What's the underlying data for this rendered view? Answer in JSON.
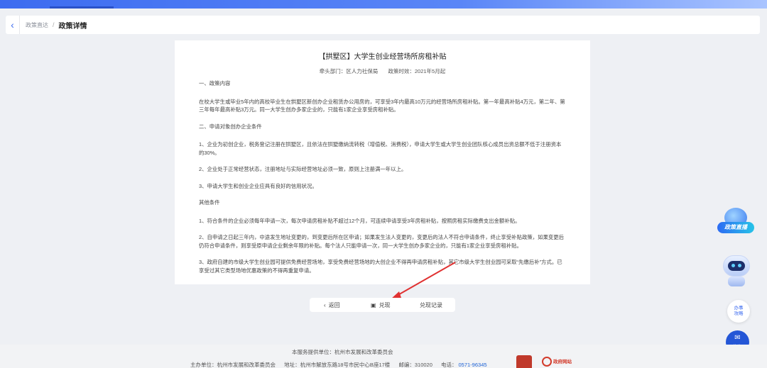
{
  "breadcrumb": {
    "back_icon": "chevron-left-icon",
    "parent": "政策直达",
    "separator": "/",
    "current": "政策详情"
  },
  "policy": {
    "title": "【拱墅区】大学生创业经营场所房租补贴",
    "department": "牵头部门：区人力社保局",
    "effective": "政策时效：2021年5月起",
    "paragraphs": [
      {
        "type": "head",
        "text": "一、政策内容"
      },
      {
        "type": "text",
        "text": "在校大学生或毕业5年内的高校毕业生在拱墅区新创办企业租赁办公用房的，可享受3年内最高10万元的经营场所房租补贴。第一年最高补贴4万元，第二年、第三年每年最高补贴3万元。同一大学生创办多家企业的，只能有1家企业享受房租补贴。"
      },
      {
        "type": "head",
        "text": "二、申请对象创办企业条件"
      },
      {
        "type": "text",
        "text": "1、企业为初创企业，税务登记注册在拱墅区，且依法在拱墅缴纳流转税（增值税、消费税），申请大学生或大学生创业团队核心成员出资总额不低于注册资本的30%。"
      },
      {
        "type": "text",
        "text": "2、企业处于正常经营状态，注册地址与实际经营地址必须一致，原则上注册满一年以上。"
      },
      {
        "type": "text",
        "text": "3、申请大学生和创业企业应具有良好的信用状况。"
      },
      {
        "type": "head",
        "text": "其他条件"
      },
      {
        "type": "text",
        "text": "1、符合条件的企业必须每年申请一次，每次申请房租补贴不超过12个月，可连续申请享受3年房租补贴，按照房租实际缴费支出金额补贴。"
      },
      {
        "type": "text",
        "text": "2、自申请之日起三年内，中途发生地址变更的，到变更后所在区申请；如果发生法人变更的，变更后的法人不符合申请条件，终止享受补贴政策，如果变更后仍符合申请条件，则享受原申请企业剩余年限的补贴。每个法人只能申请一次，同一大学生创办多家企业的，只能有1家企业享受房租补贴。"
      },
      {
        "type": "text",
        "text": "3、政府自建的市级大学生创业园可提供免费经营场地，享受免费经营场地的大创企业不得再申请房租补贴，其它市级大学生创业园可采取“先缴后补”方式。已享受过其它类型场地优惠政策的不得再重复申请。"
      }
    ]
  },
  "actions": {
    "back_label": "返回",
    "back_icon": "chevron-left-icon",
    "redeem_label": "兑现",
    "redeem_icon": "document-icon",
    "records_label": "兑现记录"
  },
  "side": {
    "live_label": "政策直播",
    "guide_label_1": "办事",
    "guide_label_2": "攻略",
    "consult_label": "咨询"
  },
  "footer": {
    "provider": "本服务提供单位：杭州市发展和改革委员会",
    "host": "主办单位：杭州市发展和改革委员会",
    "address": "地址：杭州市解放东路18号市民中心B座17楼",
    "postcode": "邮编：310020",
    "phone_label": "电话：",
    "phone": "0571-96345",
    "gov_site": "政府网站"
  },
  "colors": {
    "accent": "#3d6cf0",
    "arrow": "#e03131",
    "phone": "#1f63d6"
  }
}
